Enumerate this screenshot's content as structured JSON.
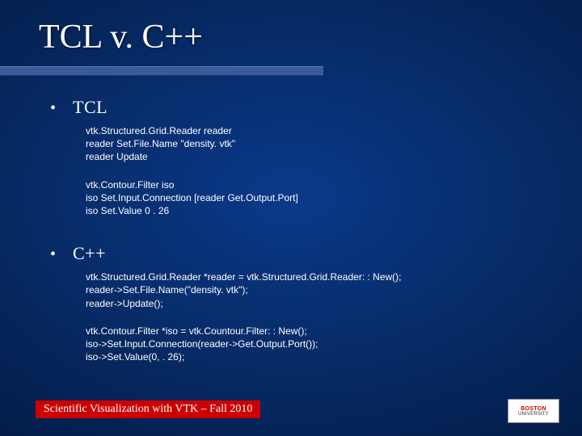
{
  "title": "TCL v. C++",
  "sections": [
    {
      "label": "TCL",
      "blocks": [
        [
          "vtk.Structured.Grid.Reader reader",
          "reader Set.File.Name \"density. vtk\"",
          "reader Update"
        ],
        [
          "vtk.Contour.Filter iso",
          "iso Set.Input.Connection [reader Get.Output.Port]",
          "iso Set.Value 0 . 26"
        ]
      ]
    },
    {
      "label": "C++",
      "blocks": [
        [
          "vtk.Structured.Grid.Reader *reader = vtk.Structured.Grid.Reader: : New();",
          "reader->Set.File.Name(\"density. vtk\");",
          "reader->Update();"
        ],
        [
          "vtk.Contour.Filter *iso = vtk.Countour.Filter: : New();",
          "iso->Set.Input.Connection(reader->Get.Output.Port());",
          "iso->Set.Value(0, . 26);"
        ]
      ]
    }
  ],
  "footer": "Scientific Visualization with VTK – Fall 2010",
  "logo": {
    "top": "BOSTON",
    "bottom": "UNIVERSITY"
  }
}
